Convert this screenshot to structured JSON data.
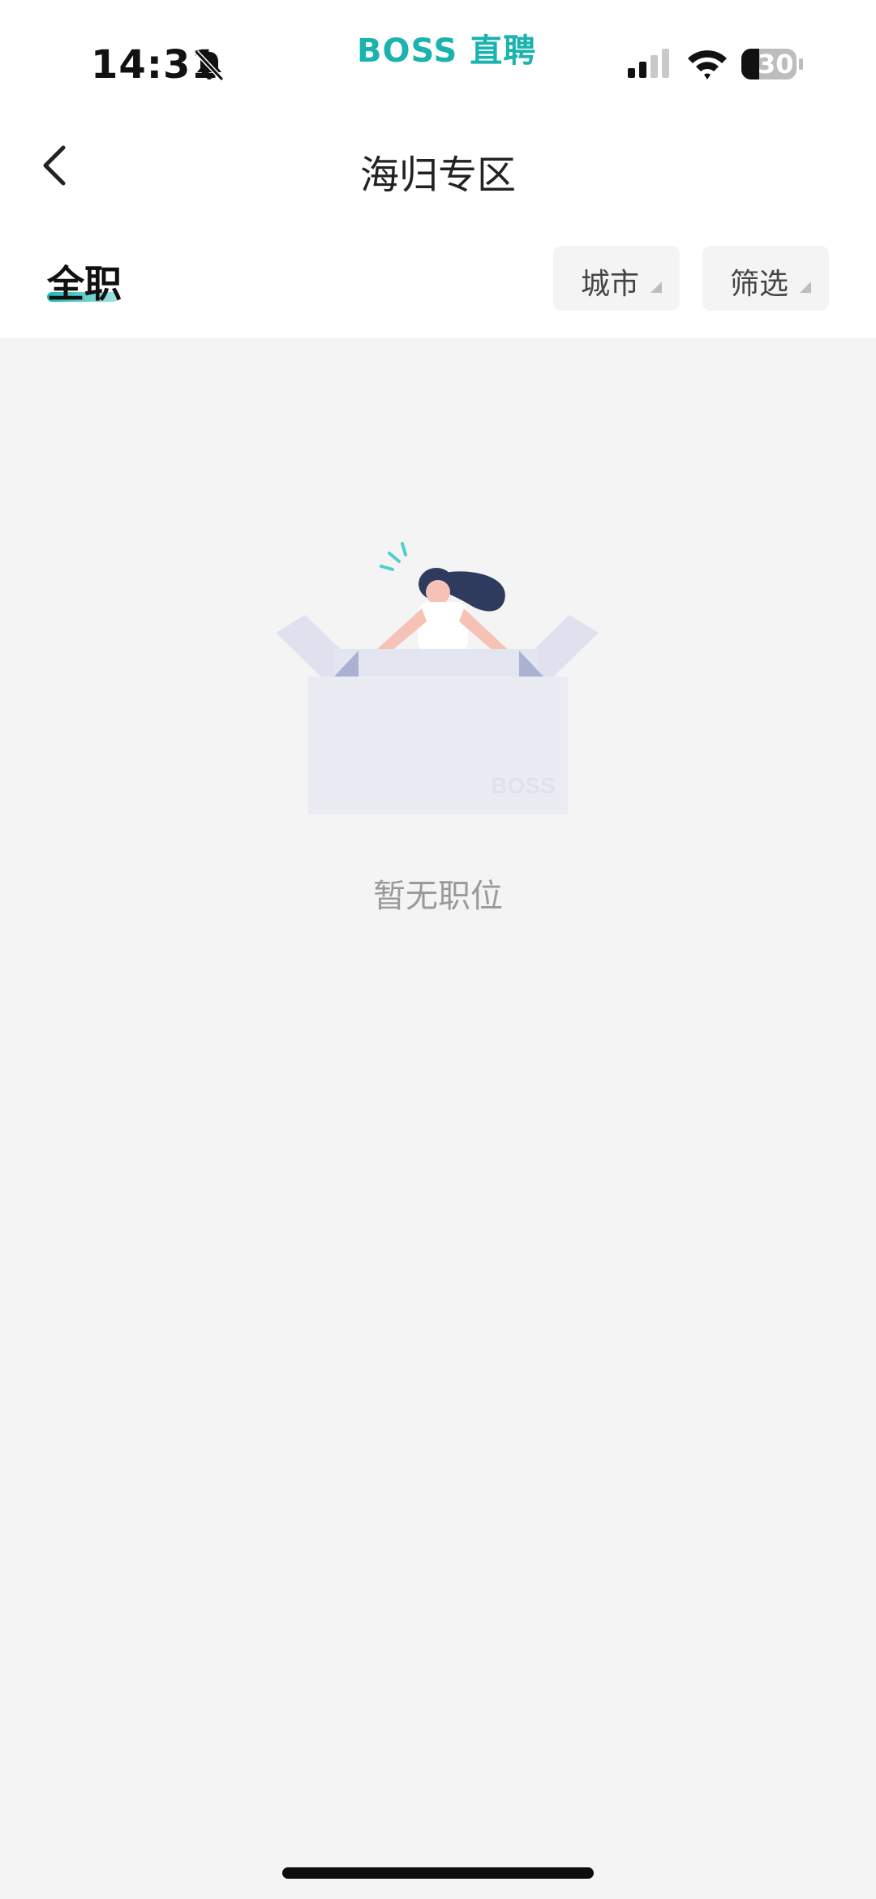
{
  "status_bar": {
    "time": "14:31",
    "brand": "BOSS 直聘",
    "battery": "30",
    "icons": [
      "bell-muted-icon",
      "cellular-signal-icon",
      "wifi-icon",
      "battery-icon"
    ]
  },
  "nav": {
    "back_icon": "chevron-left-icon",
    "title": "海归专区"
  },
  "tabs": {
    "active": "全职"
  },
  "filters": {
    "city_label": "城市",
    "filter_label": "筛选"
  },
  "empty_state": {
    "illustration_logo": "BOSS",
    "message": "暂无职位"
  },
  "colors": {
    "brand": "#1bb3ae",
    "page_bg": "#f4f4f4",
    "header_bg": "#ffffff",
    "empty_text": "#9a9a9a"
  }
}
